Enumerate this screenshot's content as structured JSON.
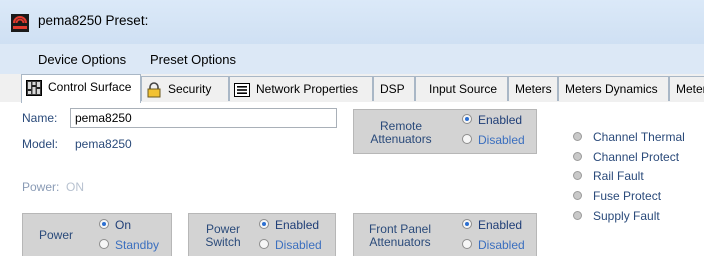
{
  "window": {
    "title": "pema8250   Preset:",
    "icon": "amplifier-app-icon"
  },
  "menu": {
    "items": [
      "Device Options",
      "Preset Options"
    ]
  },
  "tabs": [
    {
      "label": "Control Surface",
      "icon": "control-surface-icon",
      "active": true
    },
    {
      "label": "Security",
      "icon": "lock-icon",
      "active": false
    },
    {
      "label": "Network Properties",
      "icon": "network-icon",
      "active": false
    },
    {
      "label": "DSP",
      "active": false
    },
    {
      "label": "Input Source",
      "active": false
    },
    {
      "label": "Meters",
      "active": false
    },
    {
      "label": "Meters Dynamics",
      "active": false
    },
    {
      "label": "Meter",
      "active": false
    }
  ],
  "device": {
    "name_label": "Name:",
    "name_value": "pema8250",
    "model_label": "Model:",
    "model_value": "pema8250",
    "power_label": "Power:",
    "power_value": "ON"
  },
  "groups": {
    "remote_attenuators": {
      "title": "Remote\nAttenuators",
      "options": [
        "Enabled",
        "Disabled"
      ],
      "selected": "Enabled"
    },
    "power": {
      "title": "Power",
      "options": [
        "On",
        "Standby"
      ],
      "selected": "On"
    },
    "power_switch": {
      "title": "Power\nSwitch",
      "options": [
        "Enabled",
        "Disabled"
      ],
      "selected": "Enabled"
    },
    "front_panel_attenuators": {
      "title": "Front Panel\nAttenuators",
      "options": [
        "Enabled",
        "Disabled"
      ],
      "selected": "Enabled"
    }
  },
  "status_indicators": [
    "Channel Thermal",
    "Channel Protect",
    "Rail Fault",
    "Fuse Protect",
    "Supply Fault"
  ],
  "colors": {
    "label_blue": "#2a4a7a",
    "indicator_off": "#c9c9c9",
    "groupbox_bg": "#d3d3d3"
  }
}
